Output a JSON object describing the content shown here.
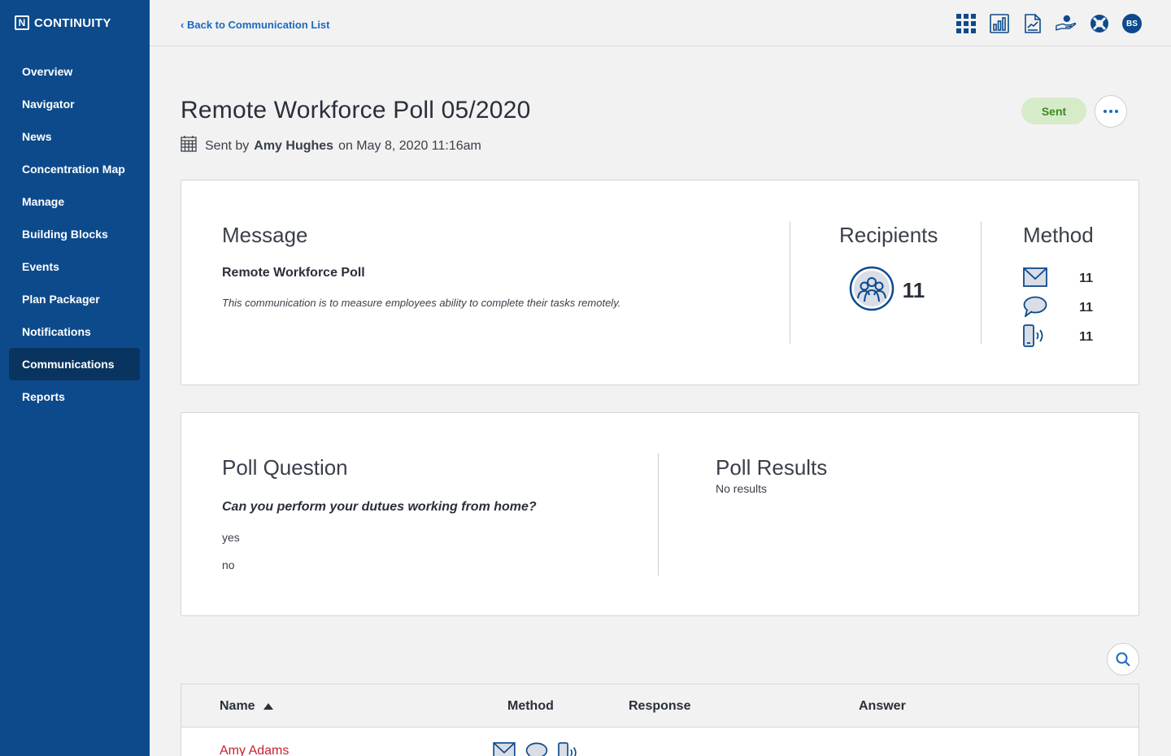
{
  "brand": {
    "name": "CONTINUITY",
    "logo_letter": "N"
  },
  "sidebar": {
    "items": [
      {
        "label": "Overview",
        "active": false
      },
      {
        "label": "Navigator",
        "active": false
      },
      {
        "label": "News",
        "active": false
      },
      {
        "label": "Concentration Map",
        "active": false
      },
      {
        "label": "Manage",
        "active": false
      },
      {
        "label": "Building Blocks",
        "active": false
      },
      {
        "label": "Events",
        "active": false
      },
      {
        "label": "Plan Packager",
        "active": false
      },
      {
        "label": "Notifications",
        "active": false
      },
      {
        "label": "Communications",
        "active": true
      },
      {
        "label": "Reports",
        "active": false
      }
    ]
  },
  "topbar": {
    "back_label": "Back to Communication List",
    "icons": [
      "apps-grid-icon",
      "bar-chart-icon",
      "document-chart-icon",
      "helping-hand-icon",
      "lifebuoy-icon"
    ],
    "avatar_initials": "BS"
  },
  "page": {
    "title": "Remote Workforce Poll 05/2020",
    "sent_prefix": "Sent by",
    "sender": "Amy Hughes",
    "sent_suffix": "on May 8, 2020 11:16am",
    "status": "Sent"
  },
  "message": {
    "heading": "Message",
    "subject": "Remote Workforce Poll",
    "body": "This communication is to measure employees ability to complete their tasks remotely."
  },
  "recipients": {
    "heading": "Recipients",
    "count": "11"
  },
  "method": {
    "heading": "Method",
    "rows": [
      {
        "icon": "email-icon",
        "count": "11"
      },
      {
        "icon": "sms-icon",
        "count": "11"
      },
      {
        "icon": "phone-call-icon",
        "count": "11"
      }
    ]
  },
  "poll": {
    "question_heading": "Poll Question",
    "question": "Can you perform your dutues working from home?",
    "answers": [
      "yes",
      "no"
    ],
    "results_heading": "Poll Results",
    "results_text": "No results"
  },
  "table": {
    "columns": [
      "Name",
      "Method",
      "Response",
      "Answer"
    ],
    "rows": [
      {
        "name": "Amy Adams"
      }
    ]
  },
  "colors": {
    "sidebar_bg": "#0d4a8c",
    "accent": "#1a6ac1",
    "status_bg": "#d6ecc9",
    "status_text": "#3d8a1f",
    "name_link": "#c8202f"
  }
}
